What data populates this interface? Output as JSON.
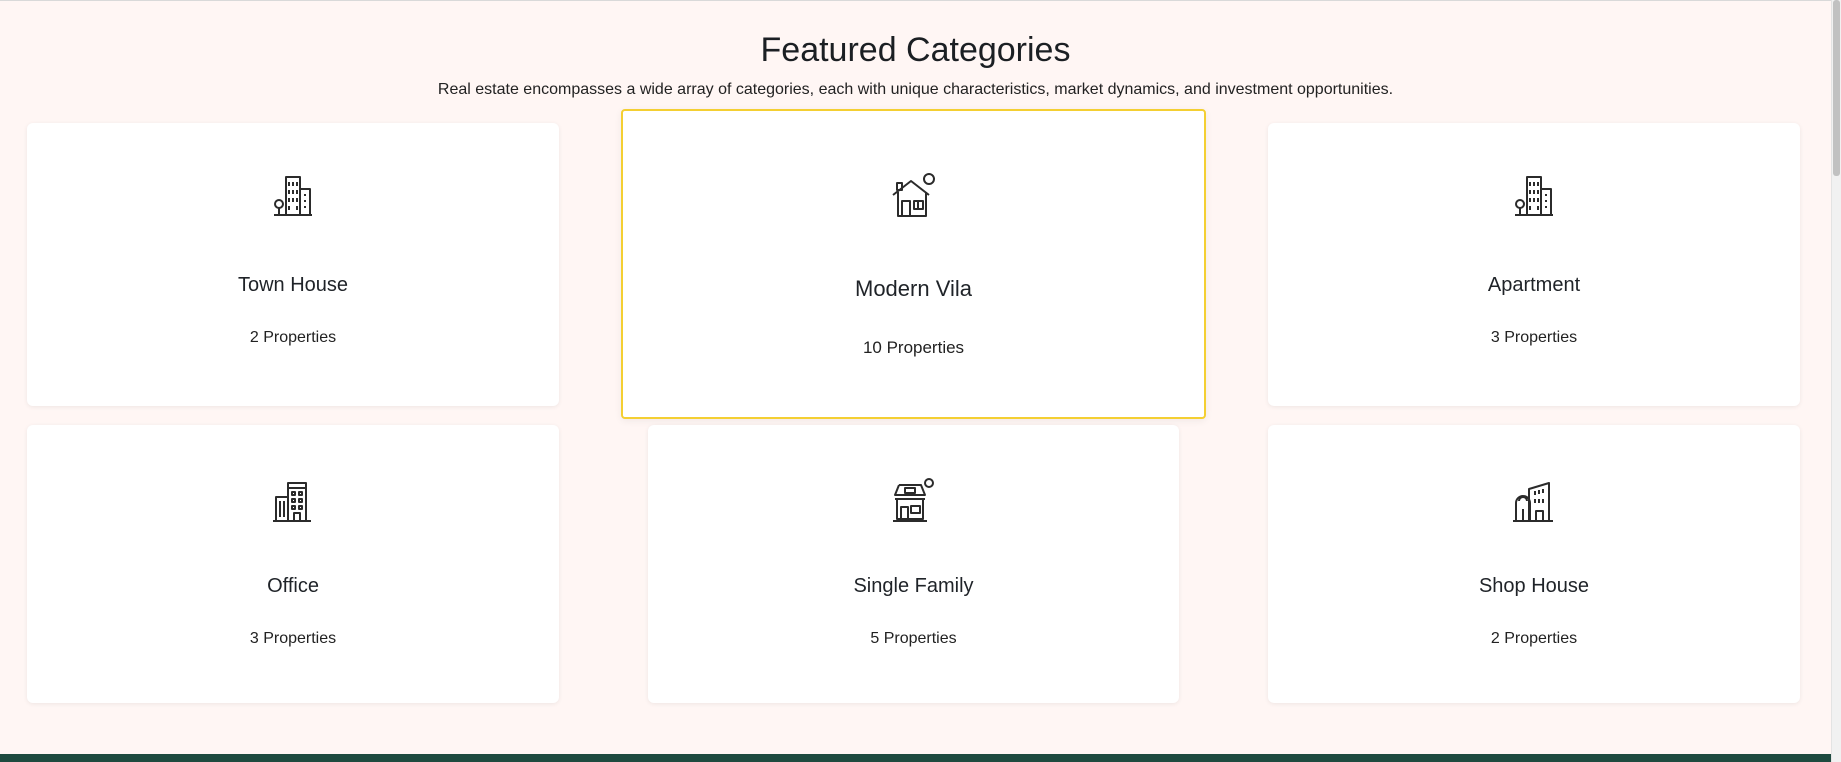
{
  "section": {
    "title": "Featured Categories",
    "subtitle": "Real estate encompasses a wide array of categories, each with unique characteristics, market dynamics, and investment opportunities."
  },
  "categories": [
    {
      "name": "Town House",
      "count": "2 Properties",
      "icon": "city-buildings-icon"
    },
    {
      "name": "Modern Vila",
      "count": "10 Properties",
      "icon": "house-with-sun-icon"
    },
    {
      "name": "Apartment",
      "count": "3 Properties",
      "icon": "city-buildings-icon"
    },
    {
      "name": "Office",
      "count": "3 Properties",
      "icon": "office-building-icon"
    },
    {
      "name": "Single Family",
      "count": "5 Properties",
      "icon": "family-house-icon"
    },
    {
      "name": "Shop House",
      "count": "2 Properties",
      "icon": "shop-building-icon"
    }
  ],
  "colors": {
    "page_background": "#fff6f4",
    "card_background": "#ffffff",
    "highlight_border": "#f4cf32",
    "footer": "#1e4a3f",
    "text": "#1f2328"
  }
}
